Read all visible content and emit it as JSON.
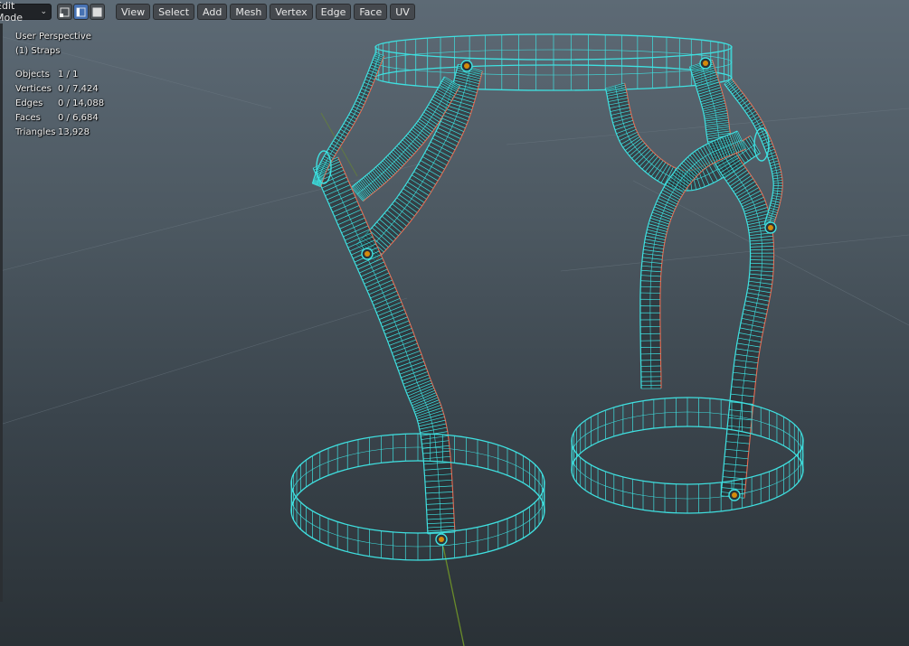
{
  "header": {
    "mode_label": "Edit Mode",
    "select_modes": [
      {
        "name": "vertex-select-icon",
        "active": false
      },
      {
        "name": "edge-select-icon",
        "active": true
      },
      {
        "name": "face-select-icon",
        "active": false
      }
    ],
    "menus": [
      "View",
      "Select",
      "Add",
      "Mesh",
      "Vertex",
      "Edge",
      "Face",
      "UV"
    ]
  },
  "overlay": {
    "view_name": "User Perspective",
    "object_name": "(1) Straps",
    "stats": [
      {
        "label": "Objects",
        "value": "1 / 1"
      },
      {
        "label": "Vertices",
        "value": "0 / 7,424"
      },
      {
        "label": "Edges",
        "value": "0 / 14,088"
      },
      {
        "label": "Faces",
        "value": "0 / 6,684"
      },
      {
        "label": "Triangles",
        "value": "13,928"
      }
    ]
  },
  "colors": {
    "viewport_top": "#5d6a75",
    "viewport_bottom": "#2a3136",
    "wire": "#3fe0e0",
    "seam": "#e86a50",
    "vertex": "#ffa000",
    "axis_green": "#6a8c2a"
  }
}
